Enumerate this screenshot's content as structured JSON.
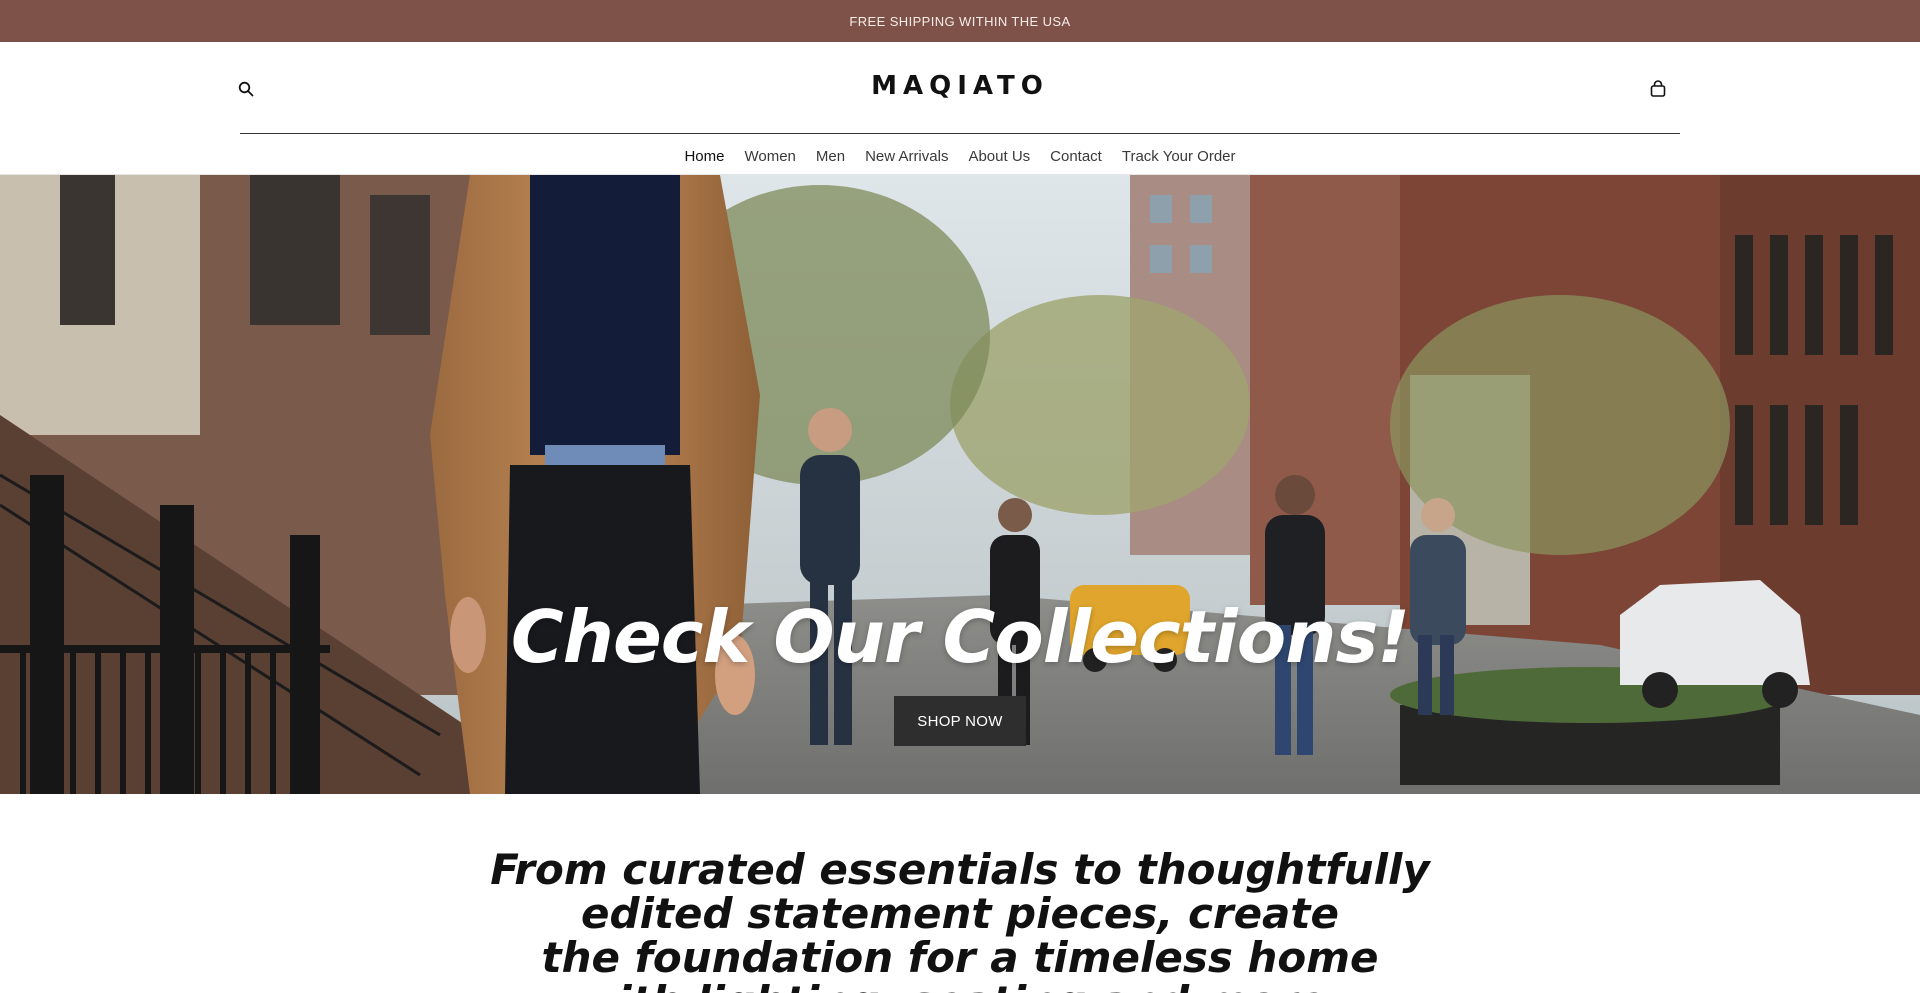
{
  "announcement": {
    "text": "FREE SHIPPING WITHIN THE USA"
  },
  "header": {
    "logo": "MAQIATO",
    "search_icon": "search-icon",
    "cart_icon": "shopping-bag-icon"
  },
  "nav": {
    "items": [
      {
        "label": "Home",
        "active": true
      },
      {
        "label": "Women",
        "active": false
      },
      {
        "label": "Men",
        "active": false
      },
      {
        "label": "New Arrivals",
        "active": false
      },
      {
        "label": "About Us",
        "active": false
      },
      {
        "label": "Contact",
        "active": false
      },
      {
        "label": "Track Your Order",
        "active": false
      }
    ]
  },
  "hero": {
    "title": "Check Our Collections!",
    "button_label": "SHOP NOW"
  },
  "intro": {
    "lines": [
      "From curated essentials to thoughtfully",
      "edited statement pieces, create",
      "the foundation for a timeless home",
      "with lighting, seating and more."
    ]
  },
  "colors": {
    "announcement_bg": "#7e5249",
    "announcement_text": "#f6ece8",
    "button_bg": "#2e2e2e",
    "button_text": "#ffffff",
    "text": "#111111"
  }
}
